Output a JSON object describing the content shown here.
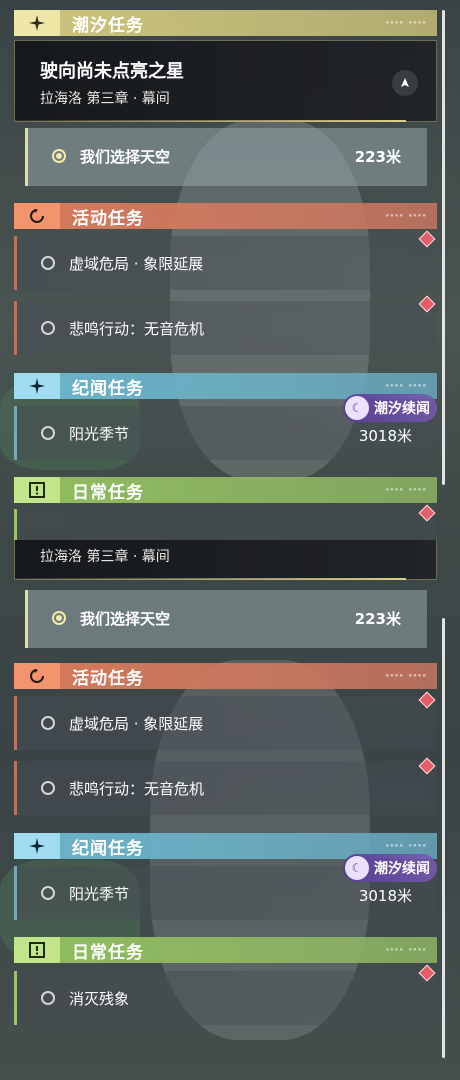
{
  "panels": [
    {
      "tide_header": "潮汐任务",
      "main_quest": {
        "title": "驶向尚未点亮之星",
        "subtitle": "拉海洛 第三章 · 幕间"
      },
      "active_quest": {
        "label": "我们选择天空",
        "distance": "223米"
      },
      "event_header": "活动任务",
      "event_quests": [
        {
          "label": "虚域危局 · 象限延展"
        },
        {
          "label": "悲鸣行动：无音危机"
        }
      ],
      "story_header": "纪闻任务",
      "story_tag": "潮汐续闻",
      "story_quest": {
        "label": "阳光季节",
        "distance": "3018米"
      },
      "daily_header": "日常任务"
    },
    {
      "main_quest": {
        "subtitle": "拉海洛 第三章 · 幕间"
      },
      "active_quest": {
        "label": "我们选择天空",
        "distance": "223米"
      },
      "event_header": "活动任务",
      "event_quests": [
        {
          "label": "虚域危局 · 象限延展"
        },
        {
          "label": "悲鸣行动：无音危机"
        }
      ],
      "story_header": "纪闻任务",
      "story_tag": "潮汐续闻",
      "story_quest": {
        "label": "阳光季节",
        "distance": "3018米"
      },
      "daily_header": "日常任务",
      "daily_quest": {
        "label": "消灭残象"
      }
    }
  ],
  "icons": {
    "tide": "sparkle-icon",
    "event": "refresh-icon",
    "story": "sparkle-icon",
    "daily": "exclamation-icon",
    "track": "track-arrow-icon",
    "tag": "moon-icon",
    "marker": "diamond-marker-icon"
  },
  "colors": {
    "tide": "#efe7a8",
    "event": "#f2956e",
    "story": "#9fdcf0",
    "daily": "#c2e58c",
    "marker": "#e25e6a",
    "tag": "#5b3fa0"
  }
}
